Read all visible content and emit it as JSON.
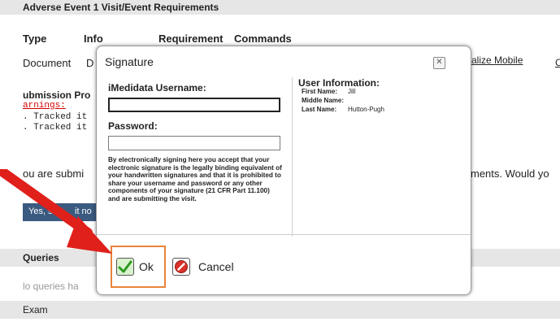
{
  "background": {
    "section_title": "Adverse Event 1 Visit/Event Requirements",
    "columns": [
      "Type",
      "Info",
      "Requirement",
      "Commands"
    ],
    "row_type": "Document",
    "row_info": "D",
    "finalize_link": "alize Mobile",
    "far_link": "C",
    "submission_label": "ubmission Pro",
    "warnings_label": "arnings:",
    "tracked_1": ". Tracked it",
    "tracked_2": ". Tracked it",
    "submitting_prefix": "ou are submi",
    "submitting_suffix": "ments. Would yo",
    "yes_button_partial": "Yes, s",
    "yes_button_tail": "it no",
    "queries_header": "Queries",
    "queries_text": "lo queries ha",
    "exam_header": "Exam"
  },
  "dialog": {
    "title": "Signature",
    "close_glyph": "✕",
    "username_label": "iMedidata Username:",
    "username_value": "",
    "password_label": "Password:",
    "password_value": "",
    "legal_text": "By electronically signing here you accept that your electronic signature is the legally binding equivalent of your handwritten signatures and that it is prohibited to share your username and password or any other components of your signature (21 CFR Part 11.100) and are submitting the visit.",
    "user_info": {
      "title": "User Information:",
      "first_name_label": "First Name:",
      "first_name": "Jill",
      "middle_name_label": "Middle Name:",
      "middle_name": "",
      "last_name_label": "Last Name:",
      "last_name": "Hutton-Pugh"
    },
    "ok_label": "Ok",
    "cancel_label": "Cancel"
  },
  "colors": {
    "highlight": "#e8843a",
    "arrow": "#e0201b",
    "band": "#e6e6e6",
    "yes_button": "#3a5a80"
  },
  "icons": [
    "close-icon",
    "ok-check-icon",
    "cancel-icon",
    "red-arrow"
  ]
}
